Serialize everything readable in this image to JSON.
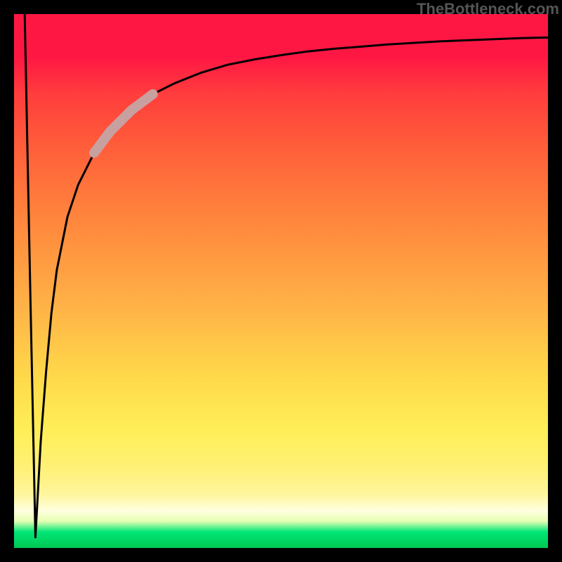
{
  "attribution": "TheBottleneck.com",
  "chart_data": {
    "type": "line",
    "title": "",
    "xlabel": "",
    "ylabel": "",
    "xlim": [
      0,
      100
    ],
    "ylim": [
      0,
      100
    ],
    "grid": false,
    "series": [
      {
        "name": "main-curve",
        "color": "#000000",
        "x": [
          2,
          3,
          4,
          5,
          6,
          7,
          8,
          10,
          12,
          15,
          18,
          22,
          26,
          30,
          35,
          40,
          45,
          50,
          55,
          60,
          65,
          70,
          75,
          80,
          85,
          90,
          95,
          100
        ],
        "y": [
          100,
          50,
          2,
          20,
          33,
          44,
          52,
          62,
          68,
          74,
          78,
          82,
          85,
          87,
          89,
          90.5,
          91.5,
          92.3,
          93,
          93.5,
          93.9,
          94.3,
          94.6,
          94.9,
          95.1,
          95.3,
          95.5,
          95.6
        ]
      },
      {
        "name": "highlight-segment",
        "color": "#c9a0a0",
        "x": [
          15,
          18,
          22,
          26
        ],
        "y": [
          74,
          78,
          82,
          85
        ]
      }
    ],
    "gradient_colors": {
      "top": "#ff1744",
      "upper_mid": "#ff8a3d",
      "mid": "#ffd94a",
      "lower_mid": "#fff59d",
      "bottom": "#00c853"
    }
  }
}
